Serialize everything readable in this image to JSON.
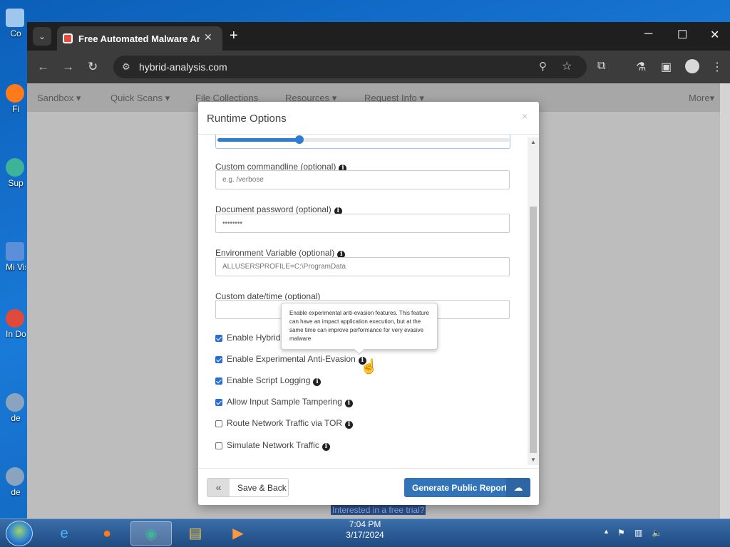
{
  "browser": {
    "tab_title": "Free Automated Malware Analysis Service",
    "url": "hybrid-analysis.com",
    "window_controls": {
      "minimize": "─",
      "maximize": "☐",
      "close": "✕"
    }
  },
  "site_nav": {
    "items": [
      "Sandbox ▾",
      "Quick Scans ▾",
      "File Collections",
      "Resources ▾",
      "Request Info ▾"
    ],
    "more": "More▾"
  },
  "background_link": "Interested in a free trial?",
  "modal": {
    "title": "Runtime Options",
    "close": "×",
    "slider_fraction": 0.28,
    "fields": [
      {
        "label": "Custom commandline (optional)",
        "placeholder": "e.g. /verbose"
      },
      {
        "label": "Document password (optional)",
        "placeholder": "••••••••"
      },
      {
        "label": "Environment Variable (optional)",
        "placeholder": "ALLUSERSPROFILE=C:\\ProgramData"
      },
      {
        "label": "Custom date/time (optional)",
        "placeholder": ""
      }
    ],
    "options": [
      {
        "label": "Enable Hybrid",
        "checked": true
      },
      {
        "label": "Enable Experimental Anti-Evasion",
        "checked": true
      },
      {
        "label": "Enable Script Logging",
        "checked": true
      },
      {
        "label": "Allow Input Sample Tampering",
        "checked": true
      },
      {
        "label": "Route Network Traffic via TOR",
        "checked": false
      },
      {
        "label": "Simulate Network Traffic",
        "checked": false
      }
    ],
    "tooltip": "Enable experimental anti-evasion features. This feature can have an impact application execution, but at the same time can improve performance for very evasive malware",
    "save_back": "Save & Back",
    "generate": "Generate Public Report"
  },
  "taskbar": {
    "time": "7:04 PM",
    "date": "3/17/2024"
  },
  "desktop_icons": [
    "Co",
    "Fi",
    "Sup",
    "Mi Visua",
    "In Do",
    "de",
    "de"
  ]
}
